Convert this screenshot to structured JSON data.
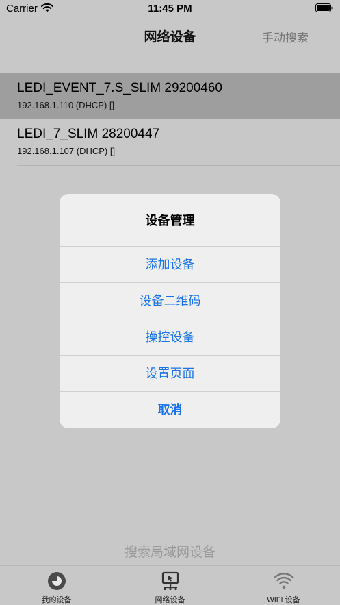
{
  "status_bar": {
    "carrier": "Carrier",
    "time": "11:45 PM"
  },
  "nav": {
    "title": "网络设备",
    "manual_search": "手动搜索"
  },
  "devices": [
    {
      "name": "LEDI_EVENT_7.S_SLIM 29200460",
      "ip": "192.168.1.110 (DHCP) []",
      "selected": true
    },
    {
      "name": "LEDI_7_SLIM 28200447",
      "ip": "192.168.1.107 (DHCP) []",
      "selected": false
    }
  ],
  "alert": {
    "title": "设备管理",
    "actions": [
      "添加设备",
      "设备二维码",
      "操控设备",
      "设置页面"
    ],
    "cancel": "取消"
  },
  "search_hint": "搜索局域网设备",
  "tabs": [
    {
      "label": "我的设备",
      "icon": "my-device-icon"
    },
    {
      "label": "网络设备",
      "icon": "network-device-icon"
    },
    {
      "label": "WIFI 设备",
      "icon": "wifi-icon"
    }
  ],
  "colors": {
    "accent": "#1a73e8",
    "background": "#c8c8c8",
    "selected_row": "#9e9e9e"
  }
}
